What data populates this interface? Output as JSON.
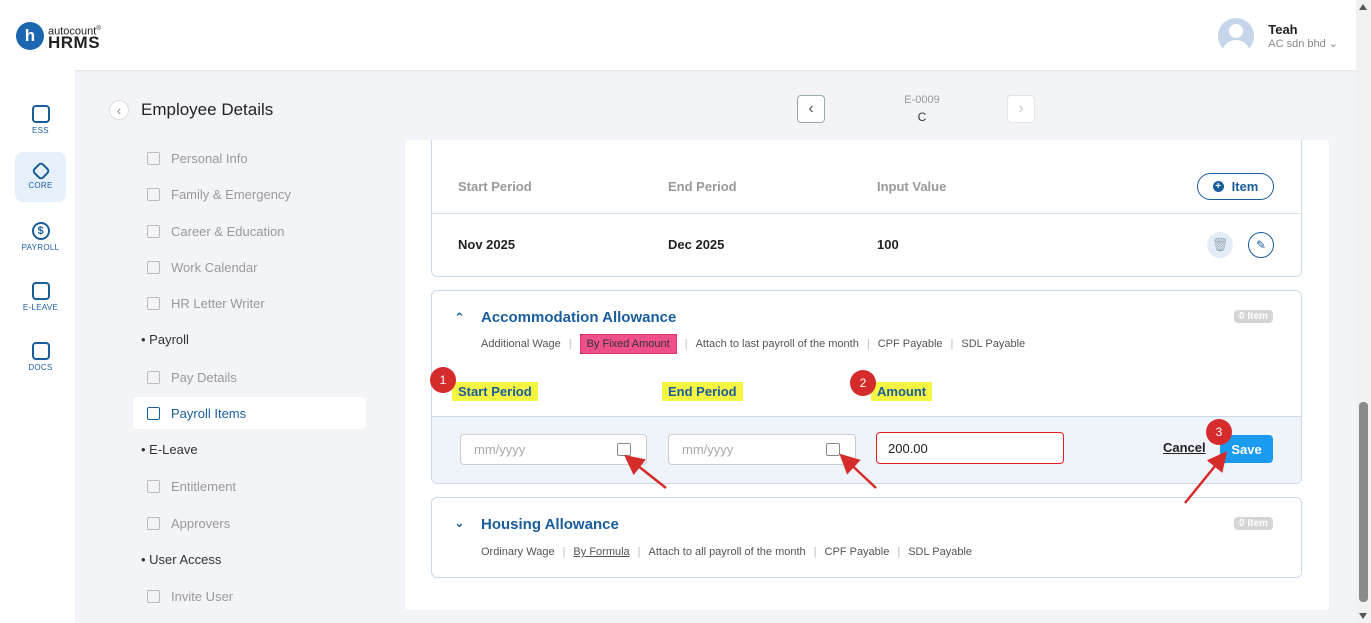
{
  "header": {
    "logo_mark": "h",
    "logo_top": "autocount",
    "logo_reg": "®",
    "logo_bottom": "HRMS",
    "user_name": "Teah",
    "user_company": "AC sdn bhd ⌄"
  },
  "rail": [
    {
      "label": "ESS",
      "icon": "ess-icon"
    },
    {
      "label": "CORE",
      "icon": "core-icon"
    },
    {
      "label": "PAYROLL",
      "icon": "payroll-icon"
    },
    {
      "label": "E-LEAVE",
      "icon": "calendar-icon"
    },
    {
      "label": "DOCS",
      "icon": "docs-icon"
    }
  ],
  "page": {
    "title": "Employee Details",
    "emp_code": "E-0009",
    "emp_name": "C"
  },
  "submenu": {
    "personal_info": "Personal Info",
    "family": "Family & Emergency",
    "career": "Career & Education",
    "work_calendar": "Work Calendar",
    "hr_letter": "HR Letter Writer",
    "payroll_head": "Payroll",
    "pay_details": "Pay Details",
    "payroll_items": "Payroll Items",
    "eleave_head": "E-Leave",
    "entitlement": "Entitlement",
    "approvers": "Approvers",
    "user_access_head": "User Access",
    "invite_user": "Invite User"
  },
  "card1": {
    "col_start": "Start Period",
    "col_end": "End Period",
    "col_input": "Input Value",
    "item_btn": "Item",
    "row": {
      "start": "Nov 2025",
      "end": "Dec 2025",
      "value": "100"
    }
  },
  "card2": {
    "title": "Accommodation Allowance",
    "badge": "0 Item",
    "tag1": "Additional Wage",
    "tag2": "By Fixed Amount",
    "tag3": "Attach to last payroll of the month",
    "tag4": "CPF Payable",
    "tag5": "SDL Payable",
    "col_start": "Start Period",
    "col_end": "End Period",
    "col_amount": "Amount",
    "start_placeholder": "mm/yyyy",
    "end_placeholder": "mm/yyyy",
    "amount_value": "200.00",
    "cancel": "Cancel",
    "save": "Save"
  },
  "card3": {
    "title": "Housing Allowance",
    "badge": "0 Item",
    "tag1": "Ordinary Wage",
    "tag2": "By Formula",
    "tag3": "Attach to all payroll of the month",
    "tag4": "CPF Payable",
    "tag5": "SDL Payable"
  },
  "steps": [
    "1",
    "2",
    "3"
  ],
  "colors": {
    "primary": "#1a5d9c",
    "save": "#1a9bf0",
    "annotation": "#d62b2b",
    "highlight_yellow": "#f5f542",
    "highlight_pink": "#f0508a"
  }
}
